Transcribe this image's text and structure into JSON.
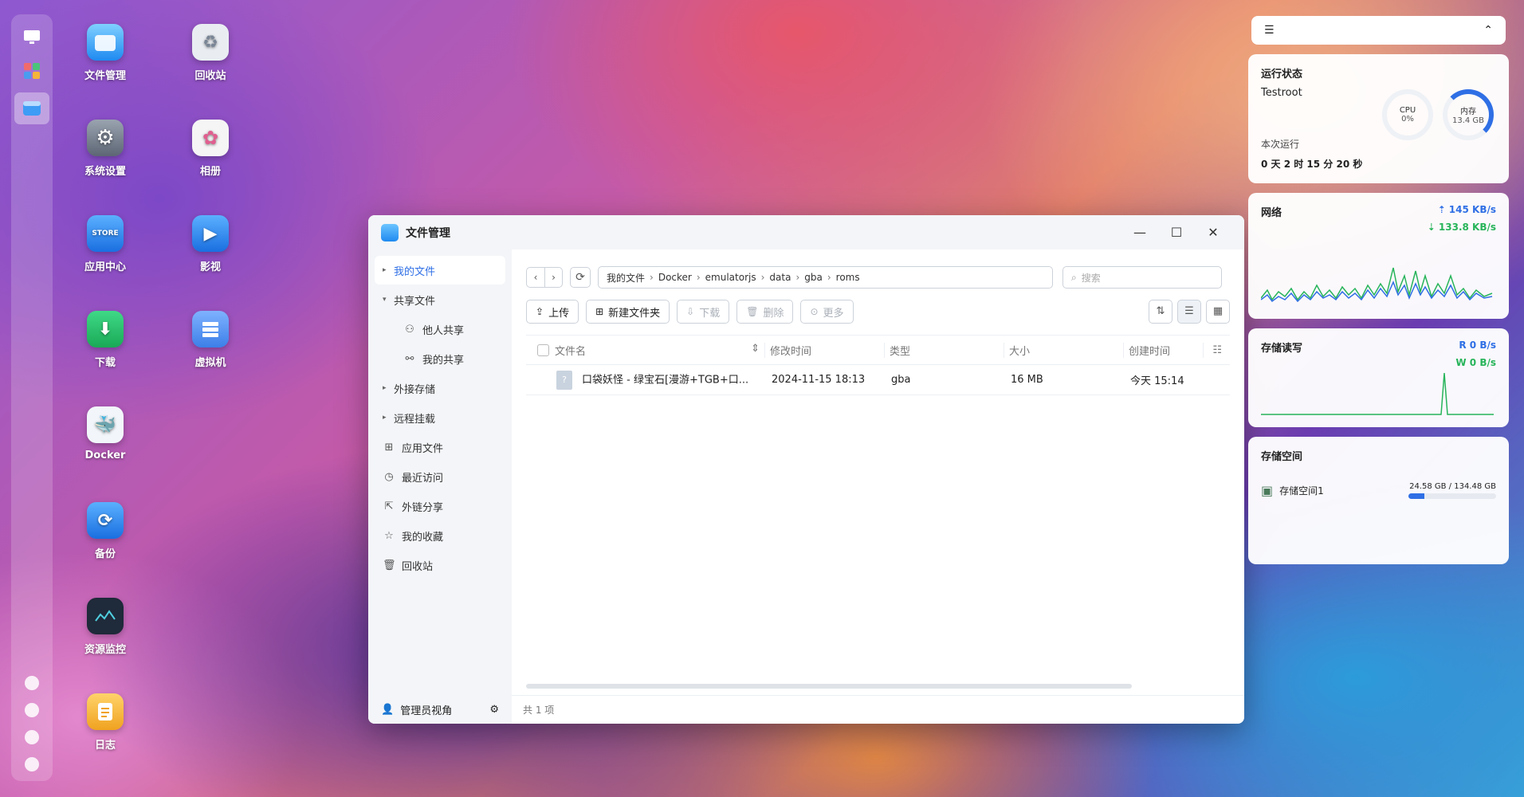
{
  "desktop": {
    "icons": [
      {
        "label": "文件管理",
        "icon": "folder-icon",
        "color": "#3d9cf5"
      },
      {
        "label": "回收站",
        "icon": "recycle-icon",
        "color": "#e9edf2"
      },
      {
        "label": "系统设置",
        "icon": "gear-icon",
        "color": "#6d7684"
      },
      {
        "label": "相册",
        "icon": "photos-icon",
        "color": "#f5f5f5"
      },
      {
        "label": "应用中心",
        "icon": "store-icon",
        "color": "#2a86f0"
      },
      {
        "label": "影视",
        "icon": "video-icon",
        "color": "#2a86f0"
      },
      {
        "label": "下载",
        "icon": "download-icon",
        "color": "#27c26a"
      },
      {
        "label": "虚拟机",
        "icon": "vm-icon",
        "color": "#4a8cf0"
      },
      {
        "label": "Docker",
        "icon": "docker-icon",
        "color": "#f2f6fa"
      },
      {
        "label": "备份",
        "icon": "backup-icon",
        "color": "#2a86f0"
      },
      {
        "label": "资源监控",
        "icon": "monitor-icon",
        "color": "#1f2a3a"
      },
      {
        "label": "日志",
        "icon": "log-icon",
        "color": "#f5b43a"
      }
    ]
  },
  "window": {
    "title": "文件管理",
    "controls": {
      "minimize": "—",
      "maximize": "☐",
      "close": "✕"
    },
    "sidebar": {
      "items": [
        {
          "label": "我的文件",
          "active": true
        },
        {
          "label": "共享文件"
        },
        {
          "label": "他人共享"
        },
        {
          "label": "我的共享"
        },
        {
          "label": "外接存储"
        },
        {
          "label": "远程挂载"
        },
        {
          "label": "应用文件"
        },
        {
          "label": "最近访问"
        },
        {
          "label": "外链分享"
        },
        {
          "label": "我的收藏"
        },
        {
          "label": "回收站"
        }
      ],
      "footer": "管理员视角"
    },
    "path": [
      "我的文件",
      "Docker",
      "emulatorjs",
      "data",
      "gba",
      "roms"
    ],
    "search_placeholder": "搜索",
    "toolbar": {
      "upload": "上传",
      "new_folder": "新建文件夹",
      "download": "下载",
      "delete": "删除",
      "more": "更多"
    },
    "columns": [
      "文件名",
      "修改时间",
      "类型",
      "大小",
      "创建时间"
    ],
    "rows": [
      {
        "name": "口袋妖怪 - 绿宝石[漫游+TGB+口...",
        "modified": "2024-11-15 18:13",
        "type": "gba",
        "size": "16 MB",
        "created": "今天 15:14"
      }
    ],
    "footer_count": "共 1 项"
  },
  "widgets": {
    "status": {
      "title": "运行状态",
      "host": "Testroot",
      "cpu_label": "CPU",
      "cpu_value": "0%",
      "mem_label": "内存",
      "mem_value": "13.4 GB",
      "uptime_label": "本次运行",
      "uptime_value": "0 天 2 时 15 分 20 秒"
    },
    "network": {
      "title": "网络",
      "up": "145 KB/s",
      "down": "133.8 KB/s"
    },
    "disk_io": {
      "title": "存储读写",
      "read": "R 0 B/s",
      "write": "W 0 B/s"
    },
    "storage": {
      "title": "存储空间",
      "pool": "存储空间1",
      "usage": "24.58 GB / 134.48 GB",
      "used_fraction": 0.18
    }
  },
  "colors": {
    "accent": "#2f6fe5",
    "net_up": "#2f6fe5",
    "net_down": "#27b45a"
  }
}
